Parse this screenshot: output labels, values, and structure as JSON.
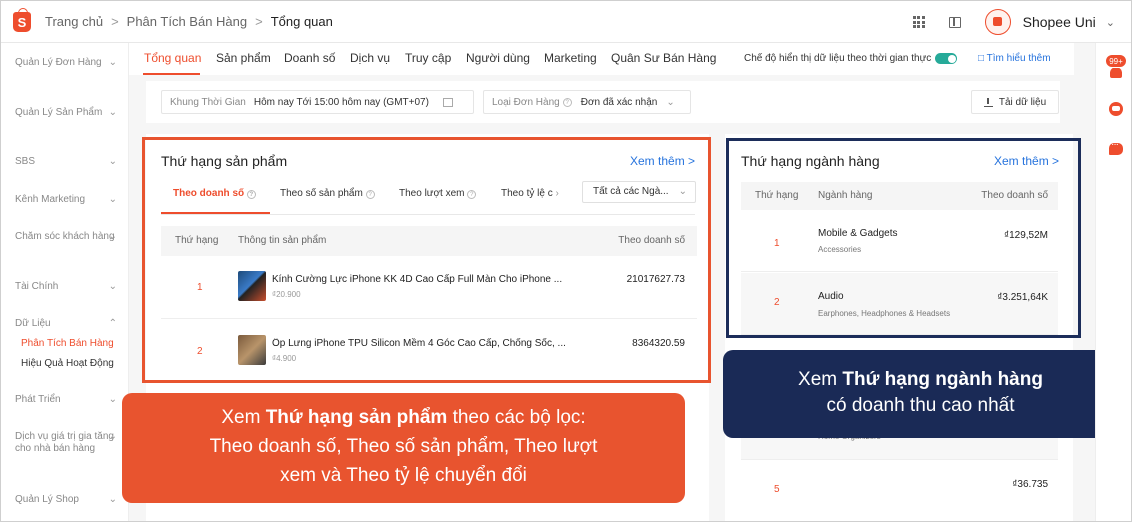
{
  "breadcrumb": [
    "Trang chủ",
    "Phân Tích Bán Hàng",
    "Tổng quan"
  ],
  "shop": {
    "name": "Shopee Uni"
  },
  "sidebar": {
    "items": [
      {
        "label": "Quản Lý Đơn Hàng",
        "expanded": false
      },
      {
        "label": "Quản Lý Sản Phẩm",
        "expanded": false
      },
      {
        "label": "SBS",
        "expanded": false
      },
      {
        "label": "Kênh Marketing",
        "expanded": false
      },
      {
        "label": "Chăm sóc khách hàng",
        "expanded": false
      },
      {
        "label": "Tài Chính",
        "expanded": false
      },
      {
        "label": "Dữ Liệu",
        "expanded": true
      },
      {
        "label": "Phát Triển",
        "expanded": false
      },
      {
        "label": "Dịch vụ giá trị gia tăng cho nhà bán hàng",
        "expanded": false
      },
      {
        "label": "Quản Lý Shop",
        "expanded": false
      }
    ],
    "sub": [
      "Phân Tích Bán Hàng",
      "Hiệu Quả Hoạt Động"
    ]
  },
  "tabs": [
    "Tổng quan",
    "Sản phẩm",
    "Doanh số",
    "Dịch vụ",
    "Truy cập",
    "Người dùng",
    "Marketing",
    "Quân Sư Bán Hàng"
  ],
  "realtime_label": "Chế độ hiển thị dữ liệu theo thời gian thực",
  "learn_more": "Tìm hiểu thêm",
  "filters": {
    "time_label": "Khung Thời Gian",
    "time_value": "Hôm nay  Tới 15:00 hôm nay (GMT+07)",
    "order_label": "Loại Đơn Hàng",
    "order_value": "Đơn đã xác nhận",
    "download": "Tải dữ liệu"
  },
  "product_rank": {
    "title": "Thứ hạng sản phẩm",
    "see_more": "Xem thêm",
    "subtabs": [
      "Theo doanh số",
      "Theo số sản phẩm",
      "Theo lượt xem",
      "Theo tỷ lệ c"
    ],
    "category_select": "Tất cả các Ngà...",
    "headers": [
      "Thứ hạng",
      "Thông tin sản phẩm",
      "Theo doanh số"
    ],
    "rows": [
      {
        "rank": "1",
        "name": "Kính Cường Lực iPhone KK 4D Cao Cấp Full Màn Cho iPhone ...",
        "price": "₫20.900",
        "sales": "21017627.73"
      },
      {
        "rank": "2",
        "name": "Ốp Lưng iPhone TPU Silicon Mềm 4 Góc Cao Cấp, Chống Sốc, ...",
        "price": "₫4.900",
        "sales": "8364320.59"
      }
    ]
  },
  "industry_rank": {
    "title": "Thứ hạng ngành hàng",
    "see_more": "Xem thêm",
    "headers": [
      "Thứ hạng",
      "Ngành hàng",
      "Theo doanh số"
    ],
    "rows": [
      {
        "rank": "1",
        "name": "Mobile & Gadgets",
        "sub": "Accessories",
        "value": "₫129,52M"
      },
      {
        "rank": "2",
        "name": "Audio",
        "sub": "Earphones, Headphones & Headsets",
        "value": "₫3.251,64K"
      },
      {
        "rank": "",
        "name": "",
        "sub": "Home Organizers",
        "value": ""
      },
      {
        "rank": "5",
        "name": "",
        "sub": "",
        "value": "₫36.735"
      }
    ]
  },
  "callouts": {
    "red": {
      "pre": "Xem ",
      "bold": "Thứ hạng sản phẩm",
      "post": " theo các bộ lọc:",
      "line2": "Theo doanh số, Theo số sản phẩm, Theo lượt",
      "line3": "xem và Theo tỷ lệ chuyển đổi"
    },
    "navy": {
      "pre": "Xem ",
      "bold": "Thứ hạng ngành hàng",
      "line2": "có doanh thu cao nhất"
    }
  },
  "notifications": {
    "badge": "99+"
  },
  "colors": {
    "brand": "#ee4d2d",
    "navy": "#1a2a56",
    "link": "#2673dd",
    "toggle": "#26aa99"
  }
}
